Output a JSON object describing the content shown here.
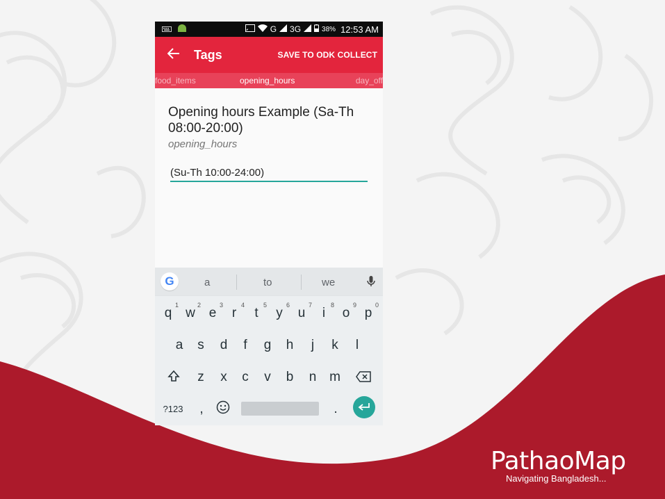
{
  "status_bar": {
    "network": "3G",
    "battery": "38%",
    "time": "12:53 AM"
  },
  "toolbar": {
    "title": "Tags",
    "action": "SAVE TO ODK COLLECT"
  },
  "tabs": [
    "food_items",
    "opening_hours",
    "day_off"
  ],
  "field": {
    "label": "Opening hours Example (Sa-Th 08:00-20:00)",
    "key": "opening_hours",
    "value": "(Su-Th 10:00-24:00)"
  },
  "keyboard": {
    "suggestions": [
      "a",
      "to",
      "we"
    ],
    "row1": [
      {
        "k": "q",
        "n": "1"
      },
      {
        "k": "w",
        "n": "2"
      },
      {
        "k": "e",
        "n": "3"
      },
      {
        "k": "r",
        "n": "4"
      },
      {
        "k": "t",
        "n": "5"
      },
      {
        "k": "y",
        "n": "6"
      },
      {
        "k": "u",
        "n": "7"
      },
      {
        "k": "i",
        "n": "8"
      },
      {
        "k": "o",
        "n": "9"
      },
      {
        "k": "p",
        "n": "0"
      }
    ],
    "row2": [
      "a",
      "s",
      "d",
      "f",
      "g",
      "h",
      "j",
      "k",
      "l"
    ],
    "row3": [
      "z",
      "x",
      "c",
      "v",
      "b",
      "n",
      "m"
    ],
    "symbols_key": "?123",
    "comma_key": ",",
    "period_key": "."
  },
  "logo": {
    "name": "PathaoMap",
    "tagline": "Navigating Bangladesh..."
  },
  "colors": {
    "toolbar": "#e3253d",
    "tab_strip": "#e84259",
    "accent": "#26a69a",
    "wave": "#ac1a2b"
  }
}
